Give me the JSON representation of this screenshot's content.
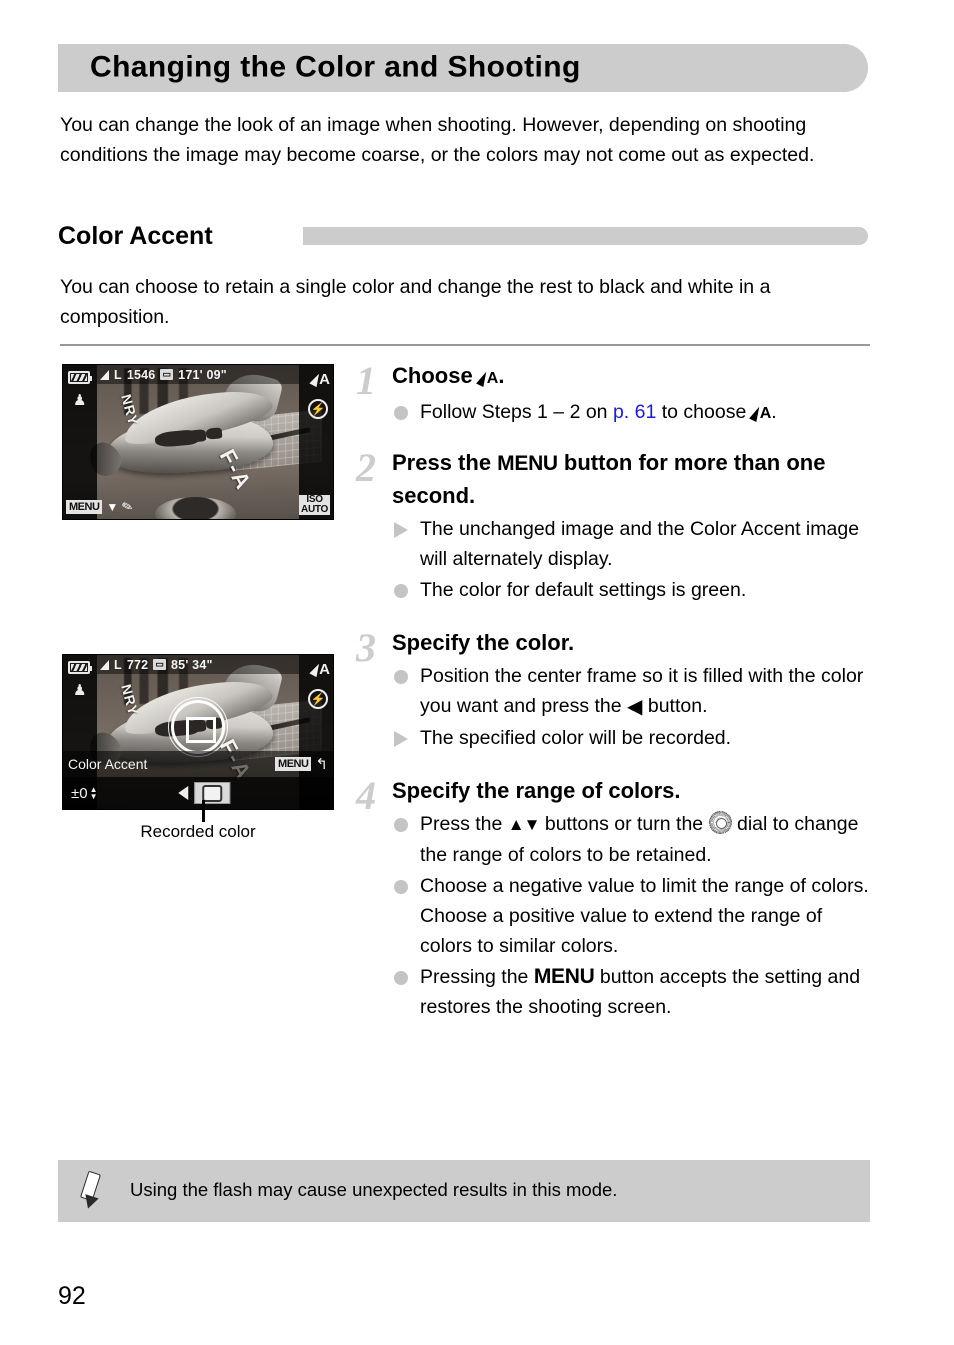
{
  "page": {
    "title": "Changing the Color and Shooting",
    "intro": "You can change the look of an image when shooting. However, depending on shooting conditions the image may become coarse, or the colors may not come out as expected.",
    "page_number": "92"
  },
  "section": {
    "heading": "Color Accent",
    "description": "You can choose to retain a single color and change the rest to black and white in a composition."
  },
  "figures": {
    "shot1": {
      "quality": "L",
      "shots_remaining": "1546",
      "movie_icon": "movie-icon",
      "movie_time": "171' 09\"",
      "battery": "battery-icon",
      "object_icon": "object-icon",
      "mode_icon": "color-accent-icon",
      "mode_letter": "A",
      "flash_icon": "flash-off-icon",
      "menu_chip": "MENU",
      "iso_label": "ISO",
      "iso_value": "AUTO",
      "plane_mark_1": "NRY",
      "plane_mark_2": "F-A"
    },
    "shot2": {
      "quality": "L",
      "shots_remaining": "772",
      "movie_icon": "movie-icon",
      "movie_time": "85' 34\"",
      "battery": "battery-icon",
      "object_icon": "object-icon",
      "mode_icon": "color-accent-icon",
      "mode_letter": "A",
      "flash_icon": "flash-off-icon",
      "osd_title": "Color Accent",
      "return_chip": "MENU",
      "return_arrow": "↰",
      "value": "±0",
      "plane_mark_1": "NRY",
      "plane_mark_2": "F-A"
    },
    "caption": "Recorded color"
  },
  "steps": [
    {
      "number": "1",
      "head_prefix": "Choose ",
      "head_suffix": ".",
      "bullets": [
        {
          "type": "dot",
          "parts": [
            "Follow Steps 1 – 2 on ",
            "p. 61",
            " to choose ",
            "",
            "."
          ]
        }
      ]
    },
    {
      "number": "2",
      "head_prefix": "Press the ",
      "head_menu": "MENU",
      "head_suffix": " button for more than one second.",
      "bullets": [
        {
          "type": "tri",
          "text": "The unchanged image and the Color Accent image will alternately display."
        },
        {
          "type": "dot",
          "text": "The color for default settings is green."
        }
      ]
    },
    {
      "number": "3",
      "head": "Specify the color.",
      "bullets": [
        {
          "type": "dot",
          "prefix": "Position the center frame so it is filled with the color you want and press the ",
          "symbol": "◀",
          "suffix": " button."
        },
        {
          "type": "tri",
          "text": "The specified color will be recorded."
        }
      ]
    },
    {
      "number": "4",
      "head": "Specify the range of colors.",
      "bullets": [
        {
          "type": "dot",
          "prefix": "Press the ",
          "symbol": "▲▼",
          "middle": " buttons or turn the ",
          "dial": "dial-icon",
          "suffix": " dial to change the range of colors to be retained."
        },
        {
          "type": "dot",
          "text": "Choose a negative value to limit the range of colors. Choose a positive value to extend the range of colors to similar colors."
        },
        {
          "type": "dot",
          "prefix": "Pressing the ",
          "menu": "MENU",
          "suffix": " button accepts the setting and restores the shooting screen."
        }
      ]
    }
  ],
  "note": {
    "icon": "pencil-icon",
    "text": "Using the flash may cause unexpected results in this mode."
  },
  "colors": {
    "band": "#cccccc",
    "link": "#1a1ae6",
    "bullet": "#c4c4c4",
    "step_number": "#cccccc"
  }
}
